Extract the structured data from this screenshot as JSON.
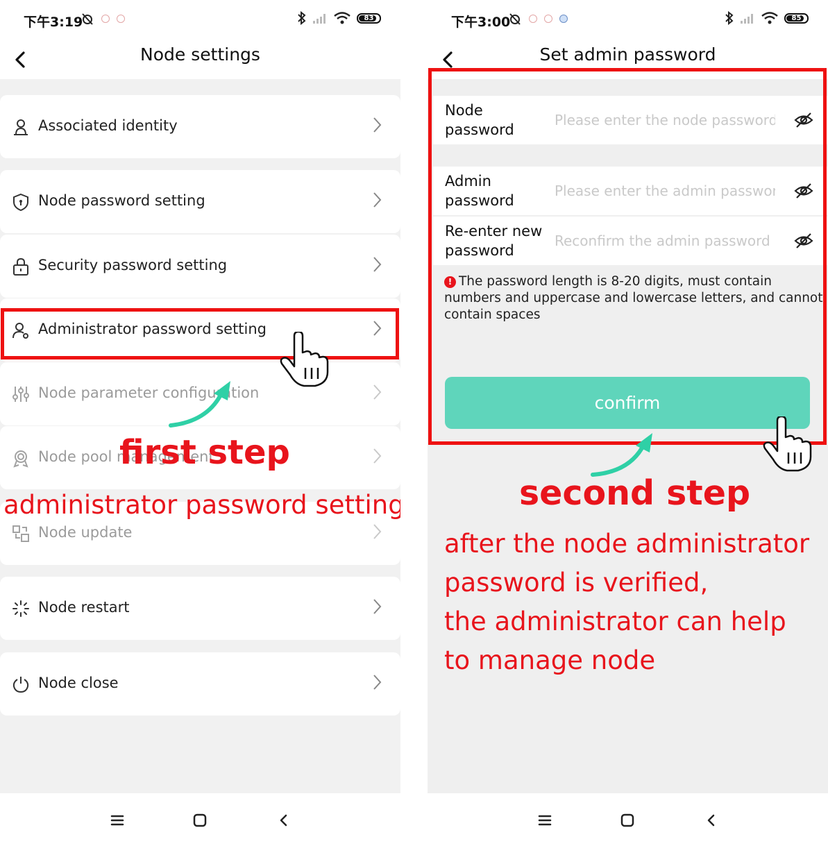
{
  "left_screen": {
    "status_bar": {
      "time": "下午3:19",
      "battery": "83"
    },
    "header": {
      "title": "Node settings"
    },
    "menu": [
      {
        "label": "Associated identity",
        "icon": "user-badge-icon"
      },
      {
        "label": "Node password setting",
        "icon": "shield-icon"
      },
      {
        "label": "Security password setting",
        "icon": "lock-icon"
      },
      {
        "label": "Administrator password setting",
        "icon": "admin-user-icon"
      },
      {
        "label": "Node parameter configuration",
        "icon": "sliders-icon"
      },
      {
        "label": "Node pool management",
        "icon": "badge-icon"
      },
      {
        "label": "Node update",
        "icon": "update-icon"
      },
      {
        "label": "Node restart",
        "icon": "loading-icon"
      },
      {
        "label": "Node close",
        "icon": "power-icon"
      }
    ],
    "annotation": {
      "step": "first step",
      "caption": "administrator password setting"
    }
  },
  "right_screen": {
    "status_bar": {
      "time": "下午3:00",
      "battery": "85"
    },
    "header": {
      "title": "Set admin password"
    },
    "form": {
      "node_password": {
        "label_line1": "Node",
        "label_line2": "password",
        "placeholder": "Please enter the node password",
        "value": ""
      },
      "admin_password": {
        "label_line1": "Admin",
        "label_line2": "password",
        "placeholder": "Please enter the admin password",
        "value": ""
      },
      "reenter_password": {
        "label_line1": "Re-enter new",
        "label_line2": "password",
        "placeholder": "Reconfirm the admin password",
        "value": ""
      },
      "hint_icon": "!",
      "hint": "The password length is 8-20 digits, must contain numbers and uppercase and lowercase letters, and cannot contain spaces",
      "confirm_label": "confirm"
    },
    "annotation": {
      "step": "second step",
      "caption_lines": [
        "after the node administrator",
        "password is verified,",
        "the administrator can help",
        "to manage node"
      ]
    }
  },
  "colors": {
    "accent": "#5fd5bb",
    "annotation_red": "#e8141c",
    "arrow_teal": "#2fd0a6"
  }
}
